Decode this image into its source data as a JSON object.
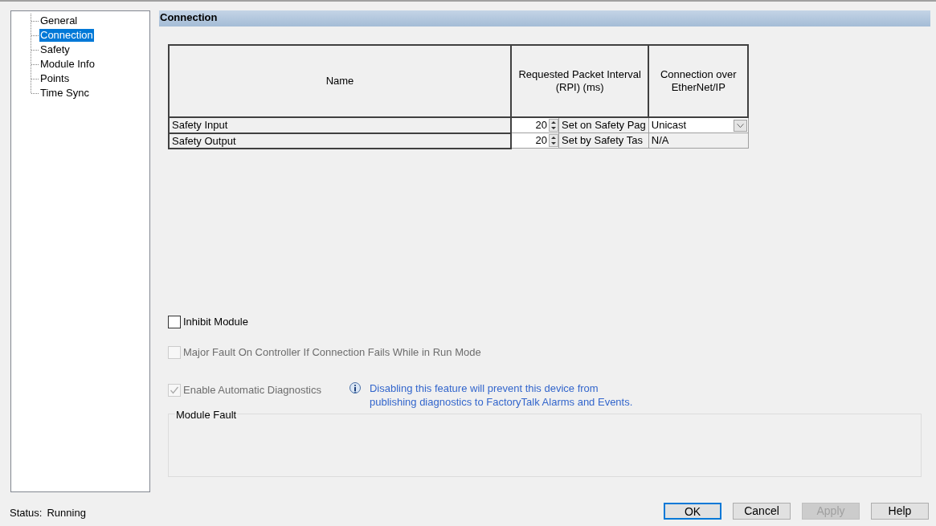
{
  "tree": [
    {
      "label": "General",
      "selected": false
    },
    {
      "label": "Connection",
      "selected": true
    },
    {
      "label": "Safety",
      "selected": false
    },
    {
      "label": "Module Info",
      "selected": false
    },
    {
      "label": "Points",
      "selected": false
    },
    {
      "label": "Time Sync",
      "selected": false
    }
  ],
  "section_title": "Connection",
  "table": {
    "columns": [
      "Name",
      "Requested Packet Interval (RPI) (ms)",
      "Connection over EtherNet/IP"
    ],
    "rows": [
      {
        "name": "Safety Input",
        "rpi": "20",
        "rpi_note": "Set on Safety Pag",
        "connection": {
          "kind": "dropdown",
          "value": "Unicast"
        }
      },
      {
        "name": "Safety Output",
        "rpi": "20",
        "rpi_note": "Set by Safety Tas",
        "connection": {
          "kind": "text",
          "value": "N/A"
        }
      }
    ]
  },
  "checkboxes": [
    {
      "label": "Inhibit Module",
      "checked": false,
      "disabled": false
    },
    {
      "label": "Major Fault On Controller If Connection Fails While in Run Mode",
      "checked": false,
      "disabled": true
    },
    {
      "label": "Enable Automatic Diagnostics",
      "checked": true,
      "disabled": true
    }
  ],
  "info_note": "Disabling this feature will prevent this device from publishing diagnostics to FactoryTalk Alarms and Events.",
  "module_fault": {
    "title": "Module Fault"
  },
  "status": {
    "label": "Status:",
    "value": "Running"
  },
  "buttons": [
    {
      "label": "OK",
      "default": true,
      "disabled": false
    },
    {
      "label": "Cancel",
      "default": false,
      "disabled": false
    },
    {
      "label": "Apply",
      "default": false,
      "disabled": true
    },
    {
      "label": "Help",
      "default": false,
      "disabled": false
    }
  ]
}
